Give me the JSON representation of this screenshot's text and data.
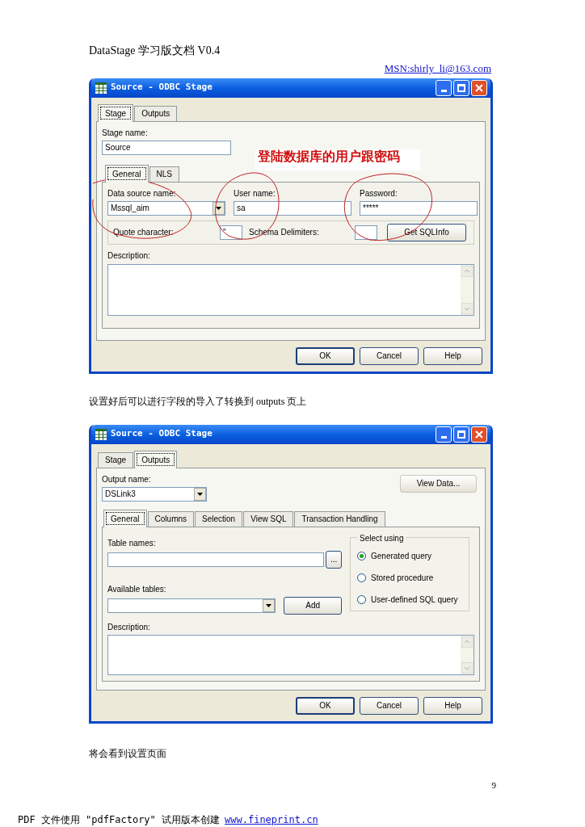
{
  "header": {
    "title": "DataStage 学习版文档 V0.4",
    "contact": "MSN:shirly_li@163.com"
  },
  "dialog_1": {
    "title": "Source - ODBC Stage",
    "tabs": [
      {
        "label": "Stage",
        "selected": true
      },
      {
        "label": "Outputs",
        "selected": false
      }
    ],
    "stage_name_label": "Stage name:",
    "stage_name": "Source",
    "subtabs": [
      {
        "label": "General",
        "selected": true
      },
      {
        "label": "NLS",
        "selected": false
      }
    ],
    "fields": [
      {
        "kind": "combo",
        "label": "Data source name:",
        "value": "Mssql_aim"
      },
      {
        "kind": "text",
        "label": "User name:",
        "value": "sa"
      },
      {
        "kind": "text",
        "label": "Password:",
        "value": "*****"
      }
    ],
    "quote_label": "Quote character:",
    "quote_value": "\"",
    "schema_label": "Schema Delimiters:",
    "sql_button": "Get SQLInfo",
    "description_label": "Description:",
    "annotation": "登陆数据库的用户跟密码",
    "buttons": [
      {
        "label": "OK",
        "default": true
      },
      {
        "label": "Cancel",
        "default": false
      },
      {
        "label": "Help",
        "default": false
      }
    ]
  },
  "caption_1": "设置好后可以进行字段的导入了转换到 outputs  页上",
  "dialog_2": {
    "title": "Source - ODBC Stage",
    "tabs": [
      {
        "label": "Stage",
        "selected": false
      },
      {
        "label": "Outputs",
        "selected": true
      }
    ],
    "output_name_label": "Output name:",
    "output_name": "DSLink3",
    "view_data": {
      "label": "View Data...",
      "disabled": true
    },
    "subtabs": [
      {
        "label": "General",
        "selected": true
      },
      {
        "label": "Columns",
        "selected": false
      },
      {
        "label": "Selection",
        "selected": false
      },
      {
        "label": "View SQL",
        "selected": false
      },
      {
        "label": "Transaction Handling",
        "selected": false
      }
    ],
    "table_names_label": "Table names:",
    "browse_button": "...",
    "available_tables_label": "Available tables:",
    "add_button": "Add",
    "select_using": {
      "title": "Select using",
      "options": [
        {
          "label": "Generated query",
          "selected": true
        },
        {
          "label": "Stored procedure",
          "selected": false
        },
        {
          "label": "User-defined SQL query",
          "selected": false
        }
      ]
    },
    "description_label": "Description:",
    "buttons": [
      {
        "label": "OK",
        "default": true
      },
      {
        "label": "Cancel",
        "default": false
      },
      {
        "label": "Help",
        "default": false
      }
    ]
  },
  "caption_2": "将会看到设置页面",
  "page_number": "9",
  "footer": {
    "text": "PDF 文件使用 \"pdfFactory\" 试用版本创建",
    "link": "www.fineprint.cn"
  }
}
